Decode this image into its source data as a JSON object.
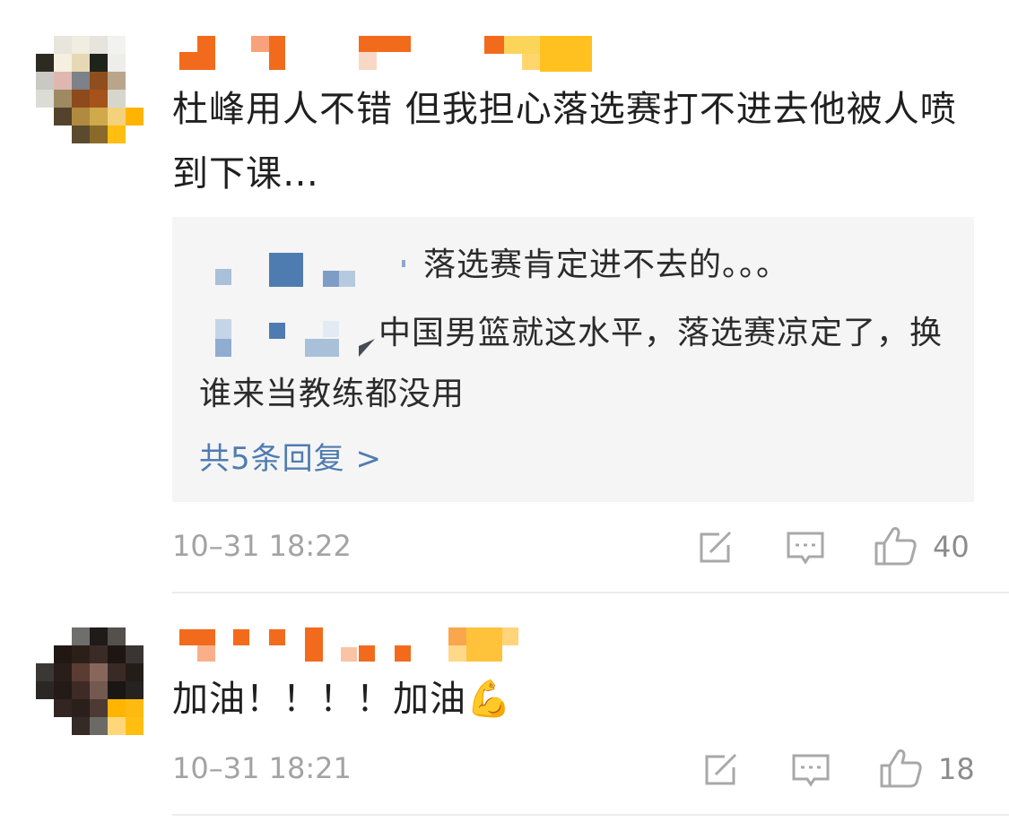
{
  "comments": [
    {
      "text": "杜峰用人不错 但我担心落选赛打不进去他被人喷到下课…",
      "replies": [
        {
          "text": "落选赛肯定进不去的。。。"
        },
        {
          "text": "中国男篮就这水平，落选赛凉定了，换谁来当教练都没用"
        }
      ],
      "reply_count_label": "共5条回复 >",
      "timestamp": "10–31 18:22",
      "like_count": "40"
    },
    {
      "text": "加油！！！！加油💪",
      "timestamp": "10–31 18:21",
      "like_count": "18"
    }
  ],
  "icons": {
    "repost": "share-icon",
    "comment": "comment-icon",
    "like": "thumbs-up-icon"
  },
  "colors": {
    "link_blue": "#4f7cb0",
    "meta_gray": "#a3a3a3",
    "reply_background": "#f5f5f5"
  }
}
